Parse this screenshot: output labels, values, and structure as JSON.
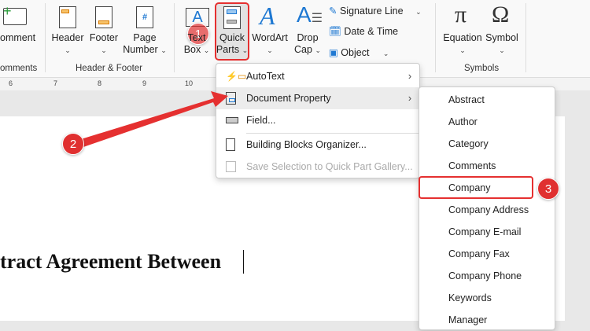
{
  "ribbon": {
    "comment": "omment",
    "comments_group": "omments",
    "header": "Header",
    "footer": "Footer",
    "page_number_1": "Page",
    "page_number_2": "Number",
    "header_footer_group": "Header & Footer",
    "text_box_1": "Text",
    "text_box_2": "Box",
    "quick_parts_1": "Quick",
    "quick_parts_2": "Parts",
    "wordart": "WordArt",
    "drop_cap_1": "Drop",
    "drop_cap_2": "Cap",
    "signature_line": "Signature Line",
    "date_time": "Date & Time",
    "object": "Object",
    "equation": "Equation",
    "symbol": "Symbol",
    "symbols_group": "Symbols"
  },
  "ruler": {
    "ticks": [
      "6",
      "7",
      "8",
      "9",
      "10"
    ]
  },
  "menu": {
    "items": [
      {
        "label": "AutoText",
        "icon": "autotext-icon",
        "submenu": true
      },
      {
        "label": "Document Property",
        "icon": "document-property-icon",
        "submenu": true
      },
      {
        "label": "Field...",
        "icon": "field-icon",
        "submenu": false
      },
      {
        "label": "Building Blocks Organizer...",
        "icon": "building-blocks-icon",
        "submenu": false
      },
      {
        "label": "Save Selection to Quick Part Gallery...",
        "icon": "save-icon",
        "submenu": false,
        "disabled": true
      }
    ]
  },
  "submenu": {
    "items": [
      "Abstract",
      "Author",
      "Category",
      "Comments",
      "Company",
      "Company Address",
      "Company E-mail",
      "Company Fax",
      "Company Phone",
      "Keywords",
      "Manager"
    ]
  },
  "document": {
    "text": "tract Agreement Between"
  },
  "badges": [
    "1",
    "2",
    "3"
  ],
  "colors": {
    "accent": "#e53030",
    "icon_blue": "#1e78d2"
  }
}
